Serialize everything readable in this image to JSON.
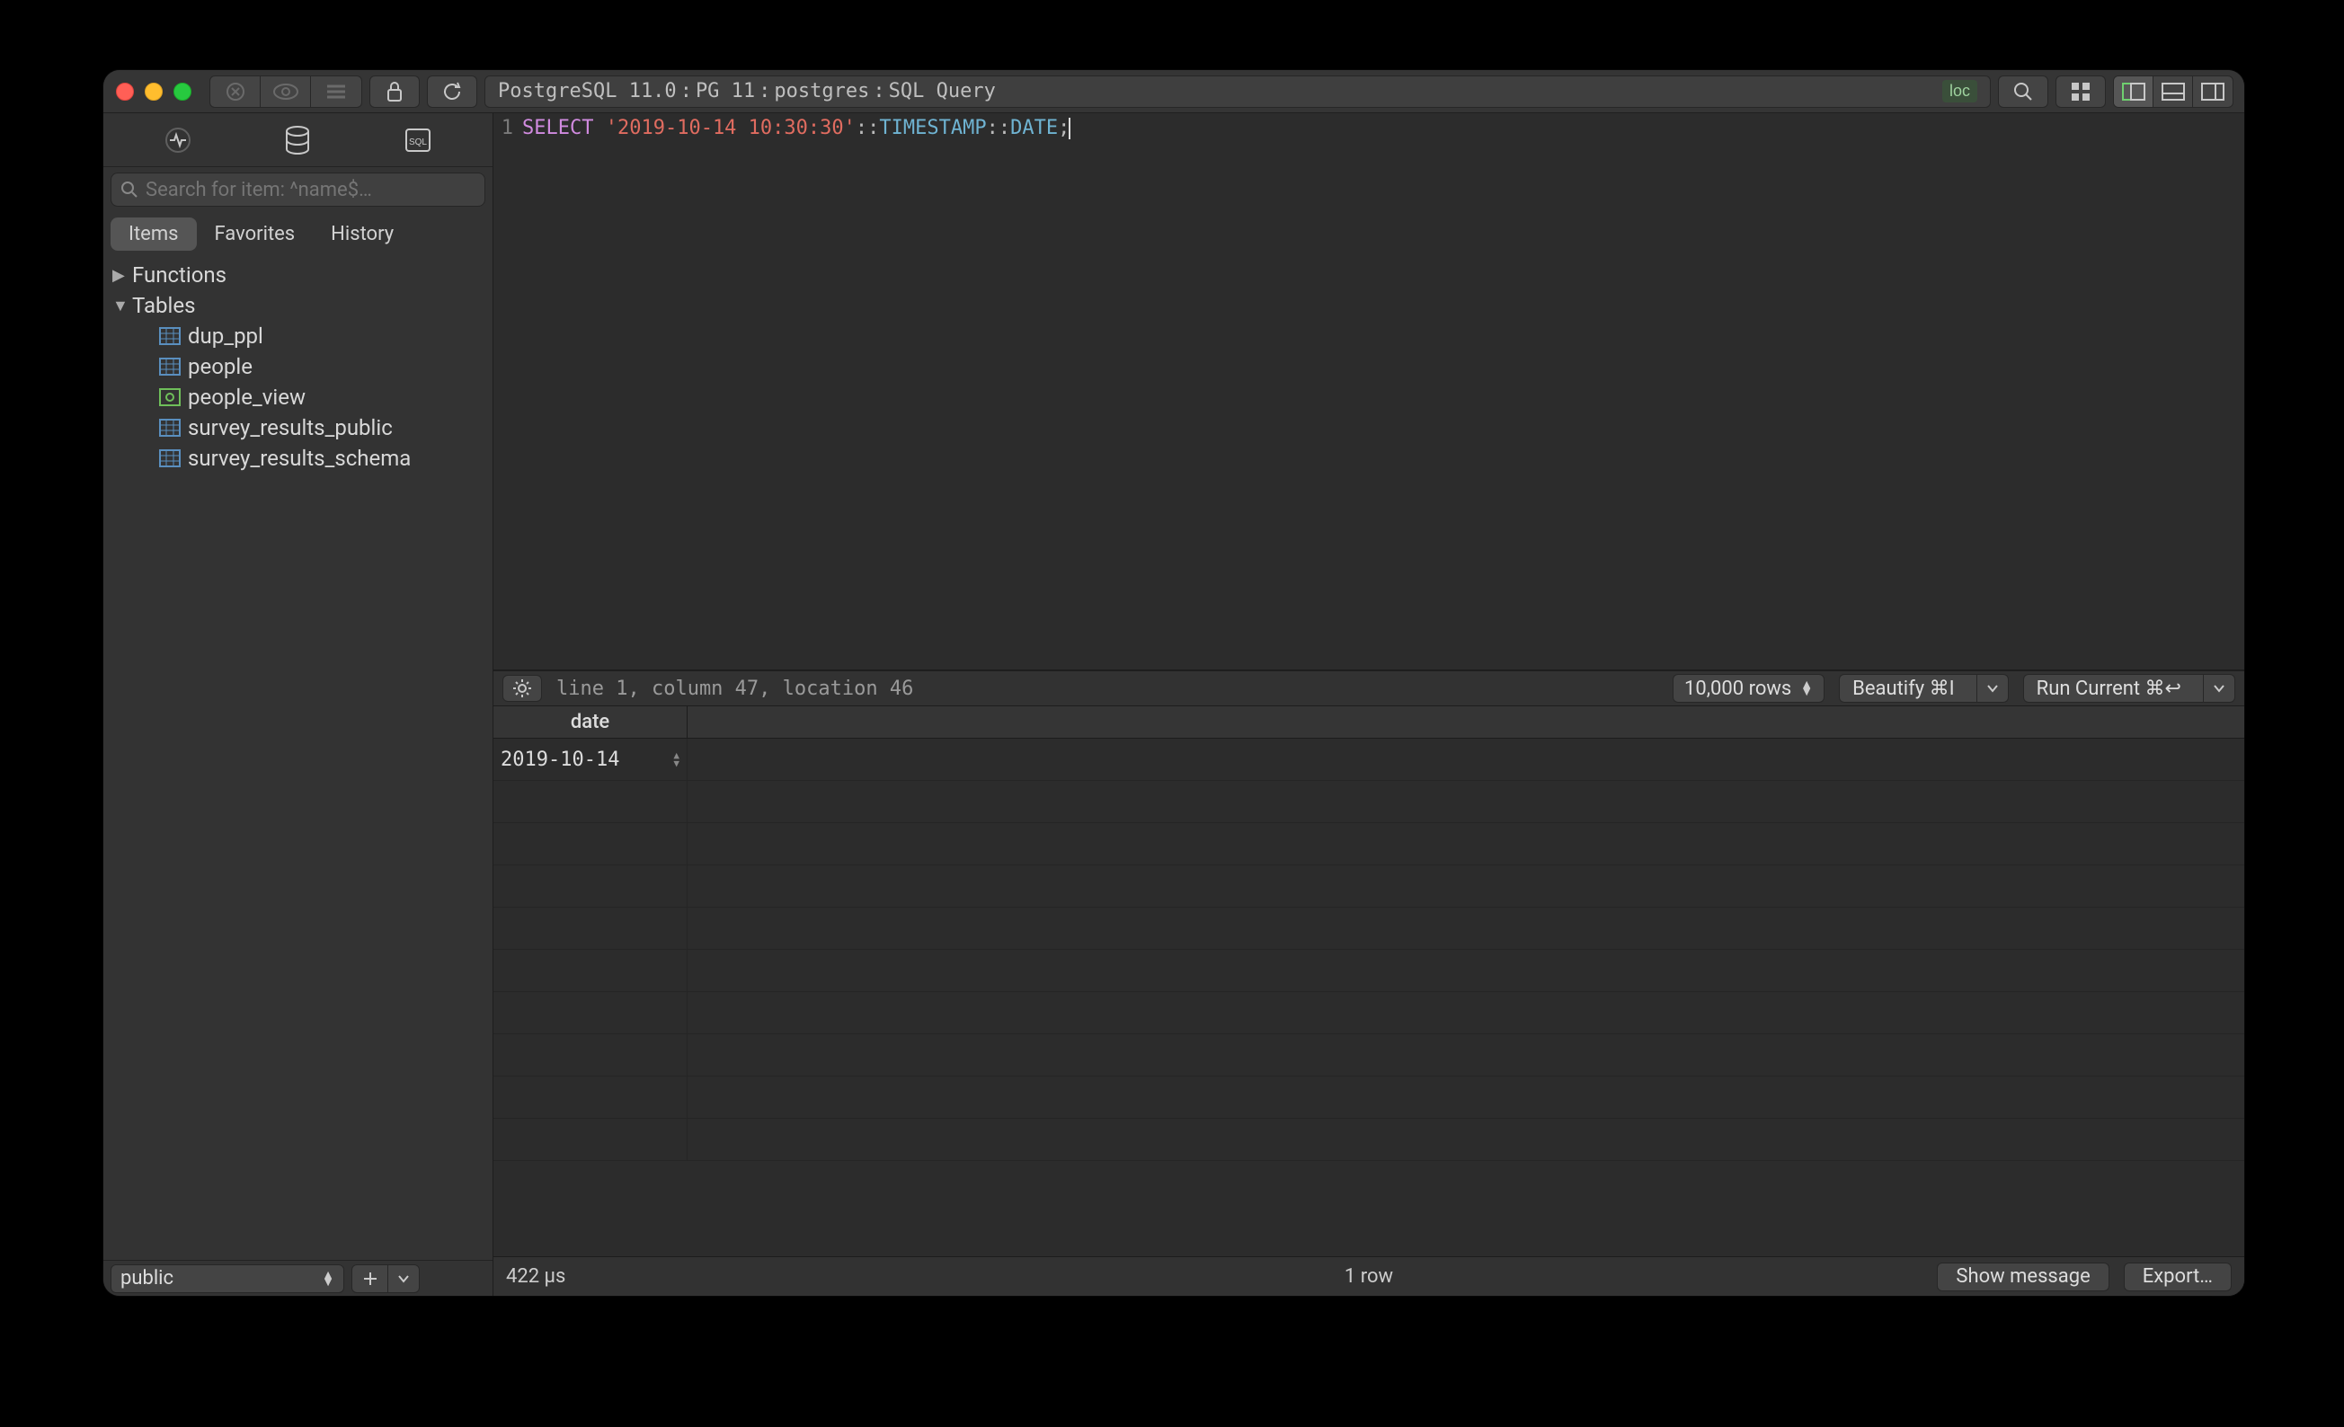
{
  "breadcrumb": {
    "db": "PostgreSQL 11.0",
    "conn": "PG 11",
    "user": "postgres",
    "mode": "SQL Query",
    "sep": " : ",
    "badge": "loc"
  },
  "sidebar": {
    "search_placeholder": "Search for item: ^name$…",
    "filters": {
      "items": "Items",
      "favorites": "Favorites",
      "history": "History"
    },
    "tree": {
      "functions": "Functions",
      "tables": "Tables",
      "table_items": [
        "dup_ppl",
        "people",
        "people_view",
        "survey_results_public",
        "survey_results_schema"
      ]
    },
    "schema": "public"
  },
  "editor": {
    "line_no": "1",
    "sql": {
      "select": "SELECT",
      "literal": "'2019-10-14 10:30:30'",
      "cast1": "::",
      "type1": "TIMESTAMP",
      "cast2": "::",
      "type2": "DATE",
      "semi": ";"
    },
    "status": "line 1, column 47, location 46",
    "rows_limit": "10,000 rows",
    "beautify": "Beautify ⌘I",
    "run": "Run Current ⌘↩"
  },
  "results": {
    "columns": [
      "date"
    ],
    "rows": [
      [
        "2019-10-14"
      ]
    ],
    "elapsed": "422 µs",
    "count": "1 row",
    "show_message": "Show message",
    "export": "Export…"
  }
}
